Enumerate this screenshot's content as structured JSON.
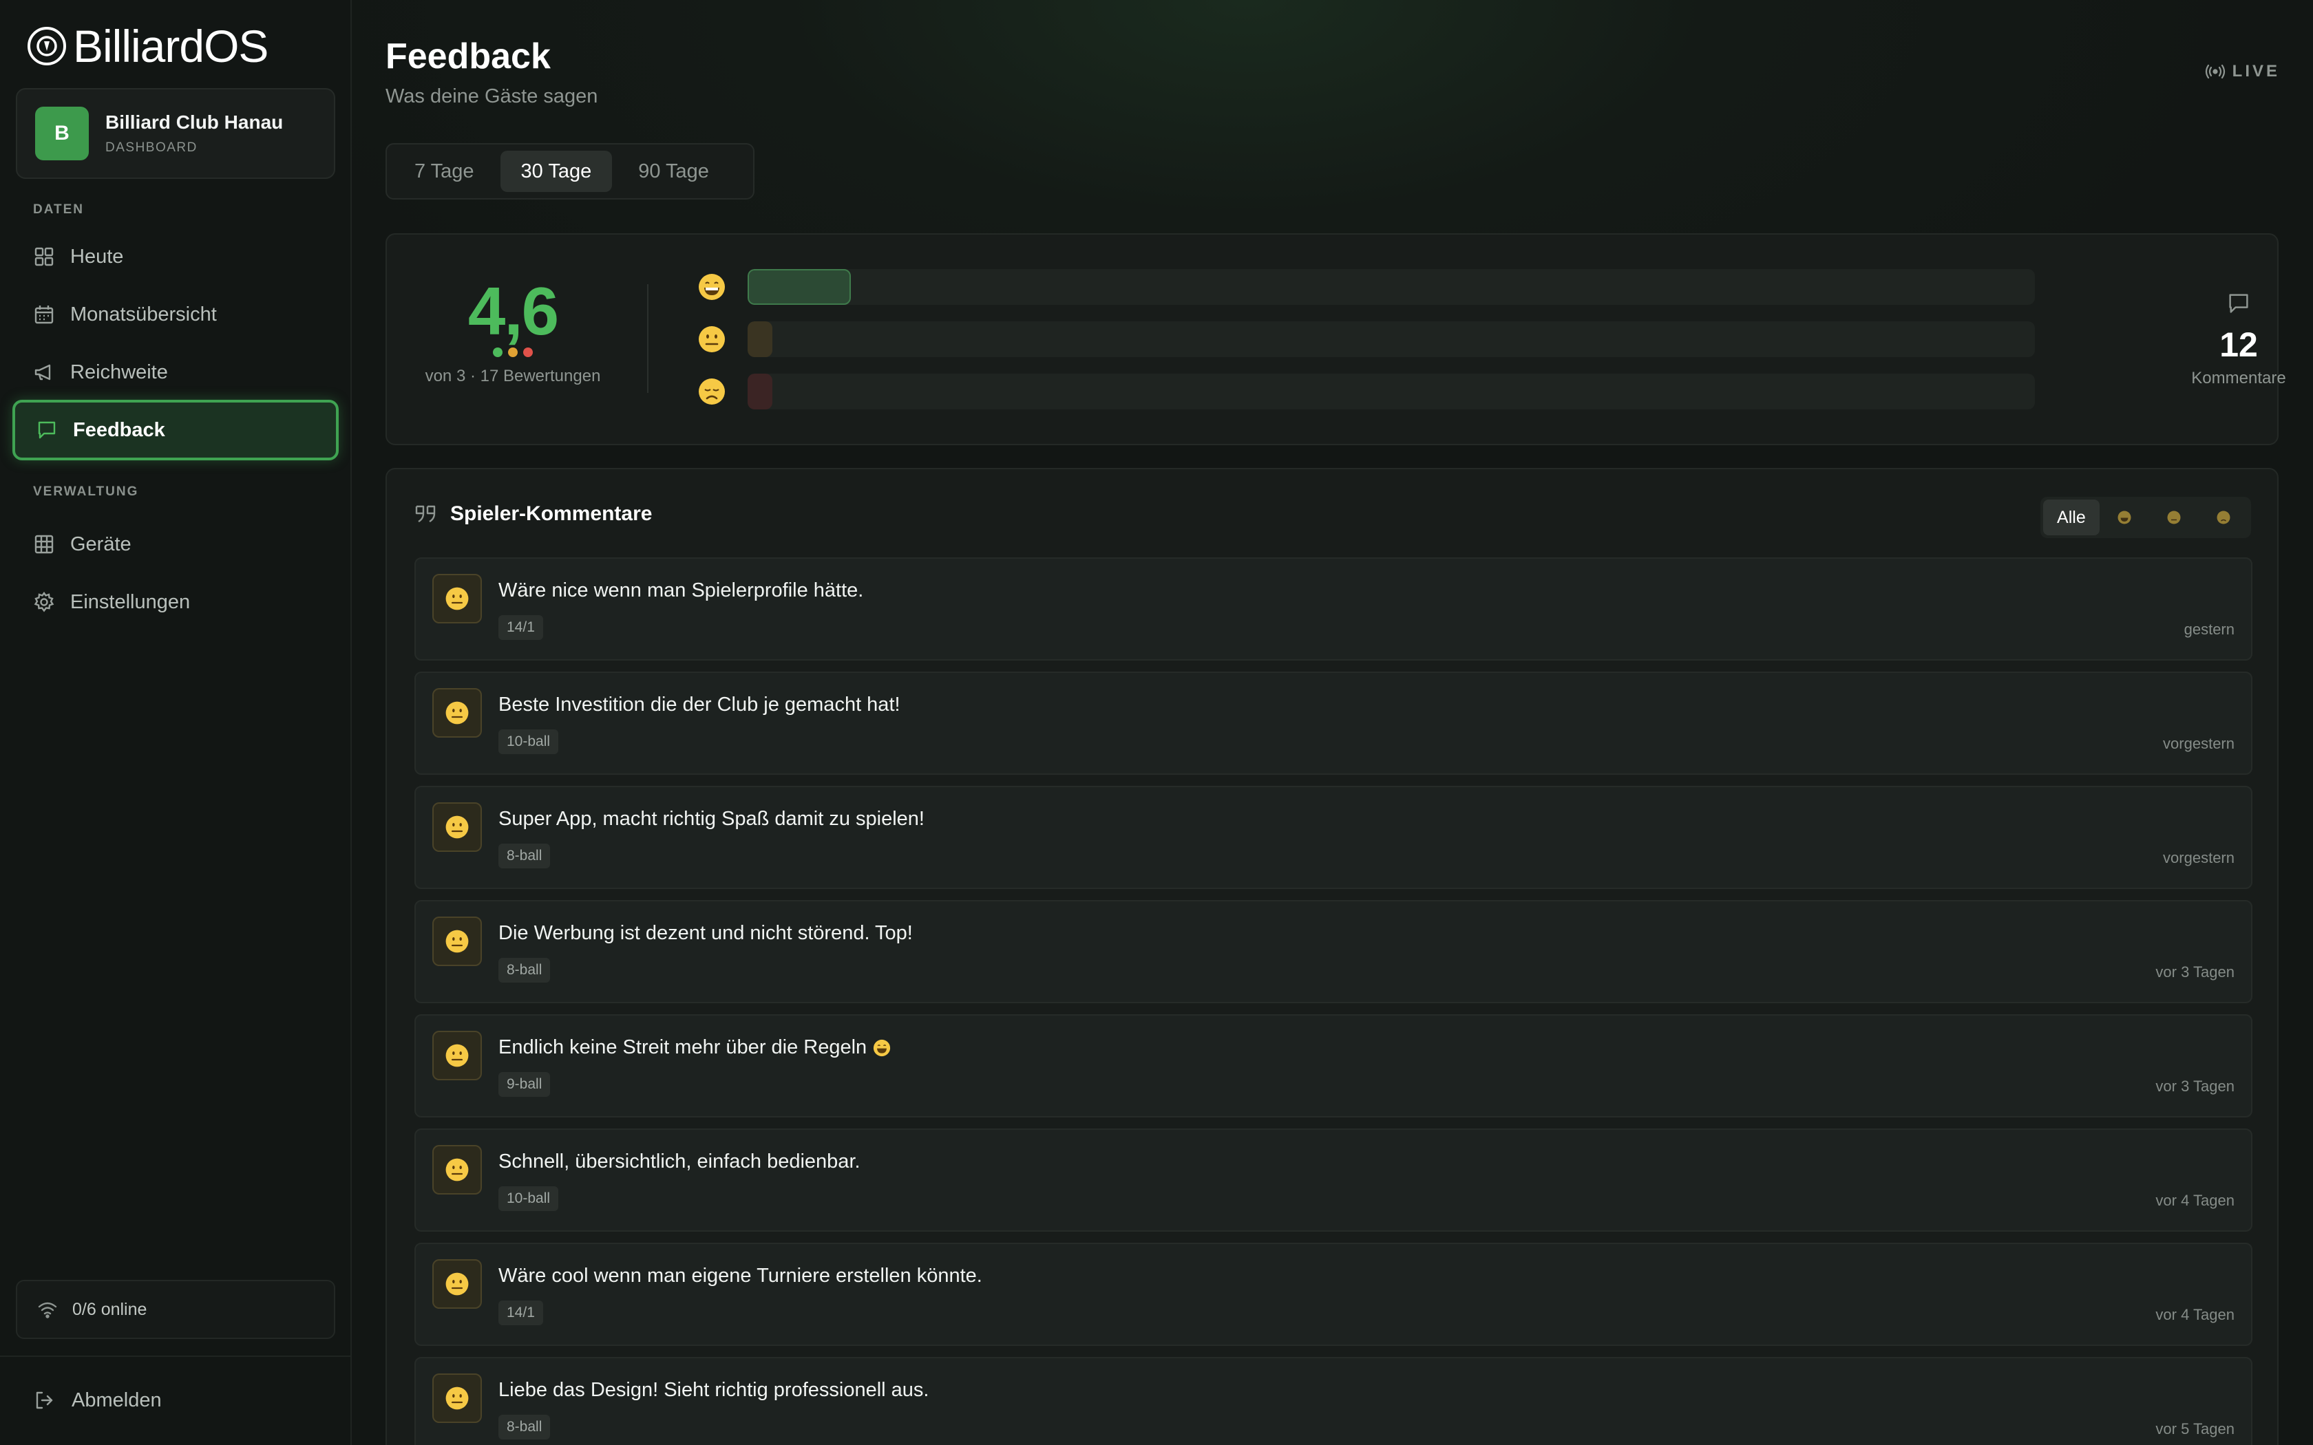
{
  "app": {
    "logo_text": "BilliardOS"
  },
  "club": {
    "avatar_letter": "B",
    "name": "Billiard Club Hanau",
    "subtitle": "DASHBOARD"
  },
  "sidebar": {
    "section_data": "DATEN",
    "section_admin": "VERWALTUNG",
    "items": [
      {
        "label": "Heute",
        "icon": "grid-icon"
      },
      {
        "label": "Monatsübersicht",
        "icon": "calendar-icon"
      },
      {
        "label": "Reichweite",
        "icon": "megaphone-icon"
      },
      {
        "label": "Feedback",
        "icon": "message-icon",
        "active": true
      },
      {
        "label": "Geräte",
        "icon": "table-grid-icon"
      },
      {
        "label": "Einstellungen",
        "icon": "gear-icon"
      }
    ],
    "online_status": "0/6 online",
    "logout_label": "Abmelden"
  },
  "header": {
    "title": "Feedback",
    "subtitle": "Was deine Gäste sagen",
    "live_label": "LIVE"
  },
  "tabs": [
    {
      "label": "7 Tage"
    },
    {
      "label": "30 Tage",
      "active": true
    },
    {
      "label": "90 Tage"
    }
  ],
  "summary": {
    "score": "4,6",
    "score_sub": "von 3 · 17 Bewertungen",
    "rows": [
      {
        "emoji": "grinning-face-icon",
        "count": "1",
        "fill": 0.08,
        "color": "#2c4a34"
      },
      {
        "emoji": "neutral-face-icon",
        "count": "0",
        "fill": 0.0,
        "color": "#3a3422"
      },
      {
        "emoji": "disappointed-face-icon",
        "count": "0",
        "fill": 0.0,
        "color": "#3b2424"
      }
    ],
    "comments_count": "12",
    "comments_label": "Kommentare",
    "colors": {
      "good": "#4dbb5c",
      "mid": "#e0a234",
      "bad": "#e0524a"
    }
  },
  "comments_panel": {
    "title": "Spieler-Kommentare",
    "filter_all": "Alle",
    "items": [
      {
        "text": "Wäre nice wenn man Spielerprofile hätte.",
        "tag": "14/1",
        "time": "gestern"
      },
      {
        "text": "Beste Investition die der Club je gemacht hat!",
        "tag": "10-ball",
        "time": "vorgestern"
      },
      {
        "text": "Super App, macht richtig Spaß damit zu spielen!",
        "tag": "8-ball",
        "time": "vorgestern"
      },
      {
        "text": "Die Werbung ist dezent und nicht störend. Top!",
        "tag": "8-ball",
        "time": "vor 3 Tagen"
      },
      {
        "text": "Endlich keine Streit mehr über die Regeln",
        "tag": "9-ball",
        "time": "vor 3 Tagen",
        "emoji": "grinning-face-icon"
      },
      {
        "text": "Schnell, übersichtlich, einfach bedienbar.",
        "tag": "10-ball",
        "time": "vor 4 Tagen"
      },
      {
        "text": "Wäre cool wenn man eigene Turniere erstellen könnte.",
        "tag": "14/1",
        "time": "vor 4 Tagen"
      },
      {
        "text": "Liebe das Design! Sieht richtig professionell aus.",
        "tag": "8-ball",
        "time": "vor 5 Tagen"
      }
    ]
  }
}
